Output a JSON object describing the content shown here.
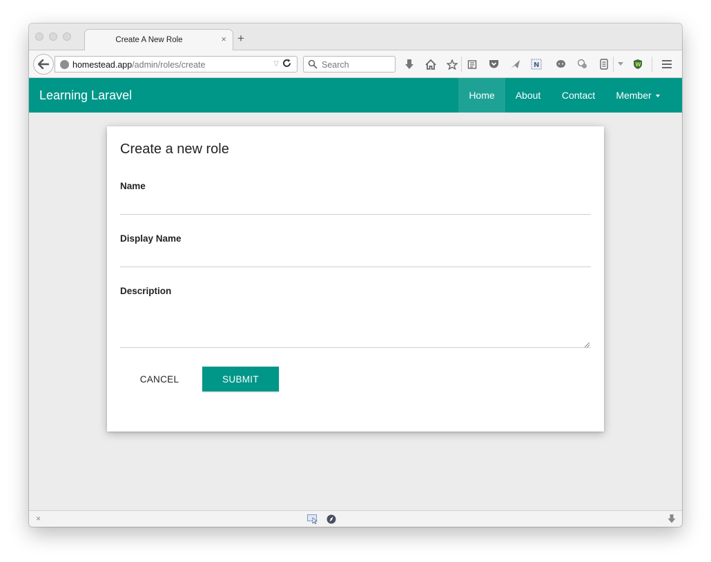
{
  "browser": {
    "tab_title": "Create A New Role",
    "tab_close": "×",
    "new_tab": "+",
    "url_host": "homestead.app",
    "url_path": "/admin/roles/create",
    "search_placeholder": "Search",
    "status_close": "×"
  },
  "navbar": {
    "brand": "Learning Laravel",
    "items": [
      {
        "label": "Home",
        "active": true
      },
      {
        "label": "About"
      },
      {
        "label": "Contact"
      },
      {
        "label": "Member"
      }
    ],
    "color": "#009688"
  },
  "form": {
    "title": "Create a new role",
    "name_label": "Name",
    "name_value": "",
    "display_name_label": "Display Name",
    "display_name_value": "",
    "description_label": "Description",
    "description_value": "",
    "cancel_label": "CANCEL",
    "submit_label": "SUBMIT"
  },
  "icons": {
    "back": "back-arrow-icon",
    "globe": "globe-icon",
    "url_dropdown": "url-dropdown-icon",
    "reload": "reload-icon",
    "search": "search-icon",
    "downloads": "download-icon",
    "home": "home-icon",
    "bookmark": "star-icon",
    "reading_list": "clipboard-icon",
    "pocket": "pocket-icon",
    "send": "paper-plane-icon",
    "onenote": "onenote-icon",
    "chat": "chat-bubble-icon",
    "extension": "extension-icon",
    "clipboard2": "notes-icon",
    "dropdown": "chevron-down-icon",
    "shield": "shield-icon",
    "menu": "hamburger-menu-icon"
  }
}
